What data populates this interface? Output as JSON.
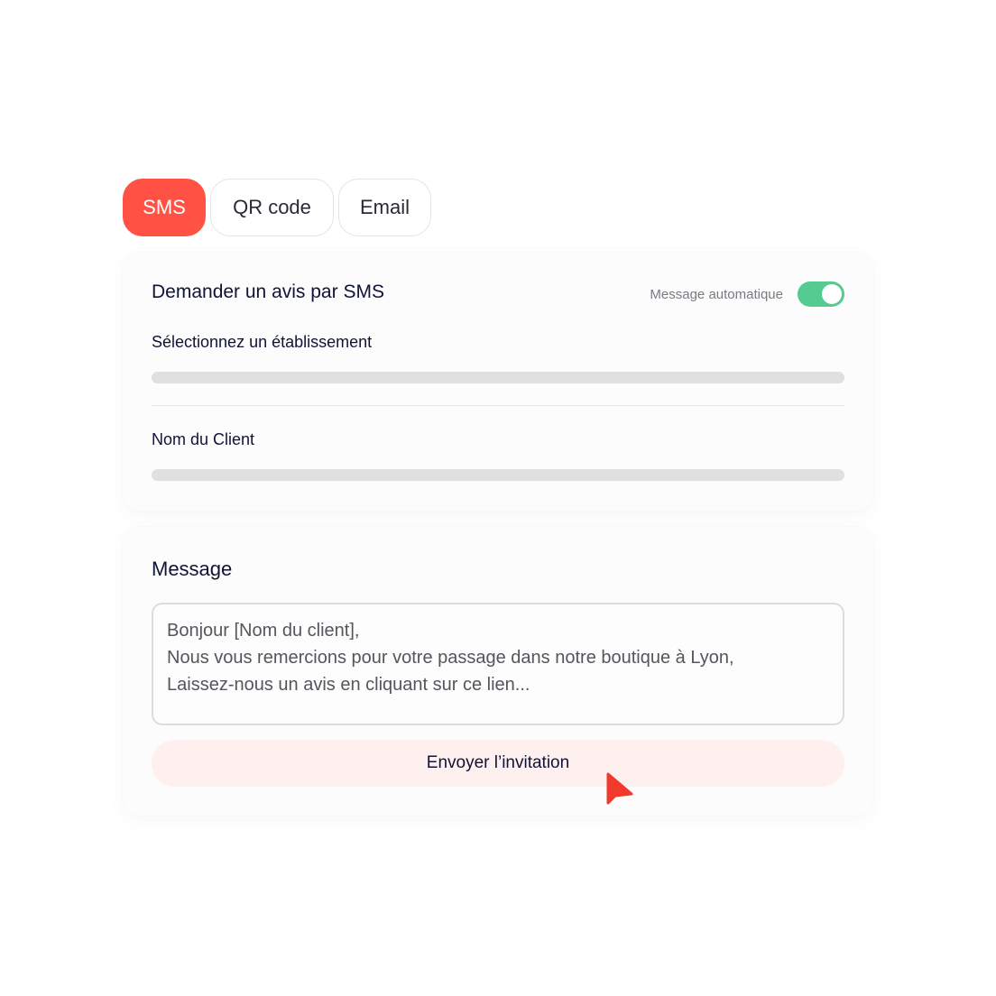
{
  "tabs": [
    {
      "label": "SMS",
      "active": true
    },
    {
      "label": "QR code",
      "active": false
    },
    {
      "label": "Email",
      "active": false
    }
  ],
  "request_card": {
    "title": "Demander un avis par SMS",
    "auto_message_label": "Message automatique",
    "auto_message_enabled": true,
    "fields": [
      {
        "label": "Sélectionnez un établissement"
      },
      {
        "label": "Nom du Client"
      }
    ]
  },
  "message_card": {
    "title": "Message",
    "body_lines": [
      "Bonjour [Nom du client],",
      "Nous vous remercions pour votre passage dans notre boutique à Lyon,",
      "Laissez-nous un avis en cliquant sur ce lien..."
    ],
    "send_label": "Envoyer l’invitation"
  },
  "colors": {
    "accent": "#ff5245",
    "toggle_on": "#55cb91",
    "send_bg": "#fff0f0",
    "text_dark": "#101338"
  },
  "icons": {
    "cursor": "mouse-pointer-icon"
  }
}
